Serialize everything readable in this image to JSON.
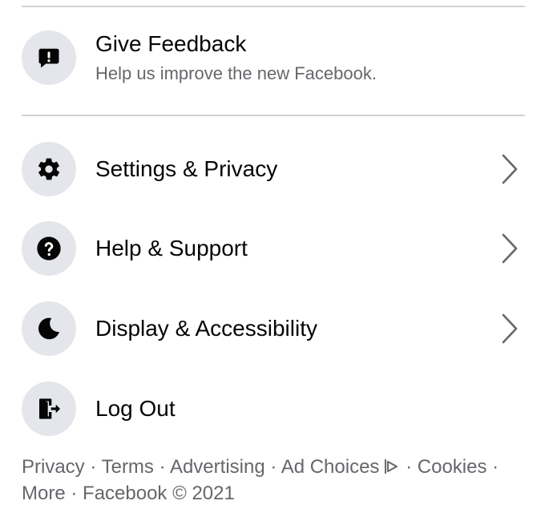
{
  "menu": {
    "feedback": {
      "label": "Give Feedback",
      "sublabel": "Help us improve the new Facebook.",
      "icon": "feedback-icon"
    },
    "settings": {
      "label": "Settings & Privacy",
      "icon": "gear-icon"
    },
    "help": {
      "label": "Help & Support",
      "icon": "question-icon"
    },
    "display": {
      "label": "Display & Accessibility",
      "icon": "moon-icon"
    },
    "logout": {
      "label": "Log Out",
      "icon": "logout-icon"
    }
  },
  "footer": {
    "privacy": "Privacy",
    "terms": "Terms",
    "advertising": "Advertising",
    "ad_choices": "Ad Choices",
    "cookies": "Cookies",
    "more": "More",
    "copyright": "Facebook © 2021",
    "separator": "·"
  },
  "colors": {
    "text_primary": "#050505",
    "text_secondary": "#65676b",
    "icon_bg": "#e4e6eb",
    "divider": "#d0d2d6"
  }
}
